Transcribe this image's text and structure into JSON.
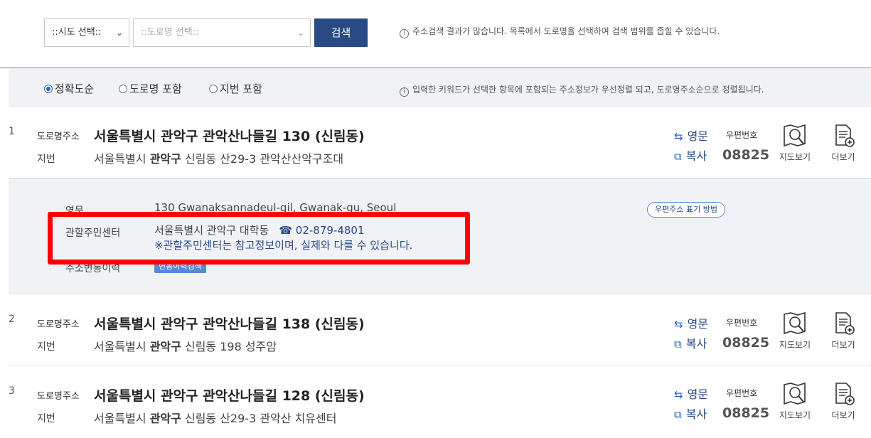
{
  "search": {
    "sido_select": "::시도 선택::",
    "road_select_placeholder": "::도로명 선택::",
    "search_button": "검색",
    "hint": "주소검색 결과가 많습니다. 목록에서 도로명을 선택하여 검색 범위를 좁힐 수 있습니다."
  },
  "options": {
    "radios": [
      {
        "label": "정확도순",
        "checked": true
      },
      {
        "label": "도로명 포함",
        "checked": false
      },
      {
        "label": "지번 포함",
        "checked": false
      }
    ],
    "hint": "입력한 키워드가 선택한 항목에 포함되는 주소정보가 우선정렬 되고, 도로명주소순으로 정렬됩니다."
  },
  "labels": {
    "road": "도로명주소",
    "jibun": "지번",
    "english": "영문",
    "copy": "복사",
    "zip_label": "우편번호",
    "map": "지도보기",
    "more": "더보기"
  },
  "results": [
    {
      "num": "1",
      "road_address": "서울특별시 관악구 관악산나들길 130 (신림동)",
      "jibun_prefix": "서울특별시",
      "jibun_gu": "관악구",
      "jibun_rest": "신림동 산29-3 관악산산악구조대",
      "zip": "08825"
    },
    {
      "num": "2",
      "road_address": "서울특별시 관악구 관악산나들길 138 (신림동)",
      "jibun_prefix": "서울특별시",
      "jibun_gu": "관악구",
      "jibun_rest": "신림동 198 성주암",
      "zip": "08825"
    },
    {
      "num": "3",
      "road_address": "서울특별시 관악구 관악산나들길 128 (신림동)",
      "jibun_prefix": "서울특별시",
      "jibun_gu": "관악구",
      "jibun_rest": "신림동 산29-3 관악산 치유센터",
      "zip": "08825"
    }
  ],
  "detail": {
    "english_label": "영문",
    "english_value": "130 Gwanaksannadeul-gil, Gwanak-gu, Seoul",
    "center_label": "관할주민센터",
    "center_value": "서울특별시 관악구 대학동",
    "phone": "☎ 02-879-4801",
    "center_note": "※관할주민센터는 참고정보이며, 실제와 다를 수 있습니다.",
    "history_label": "주소변동이력",
    "history_badge": "변동이력검색",
    "postal_rule_button": "우편주소 표기 방법"
  },
  "colors": {
    "accent": "#2a4a86",
    "highlight_box": "#ff0000",
    "panel_bg": "#f0f2f5"
  }
}
